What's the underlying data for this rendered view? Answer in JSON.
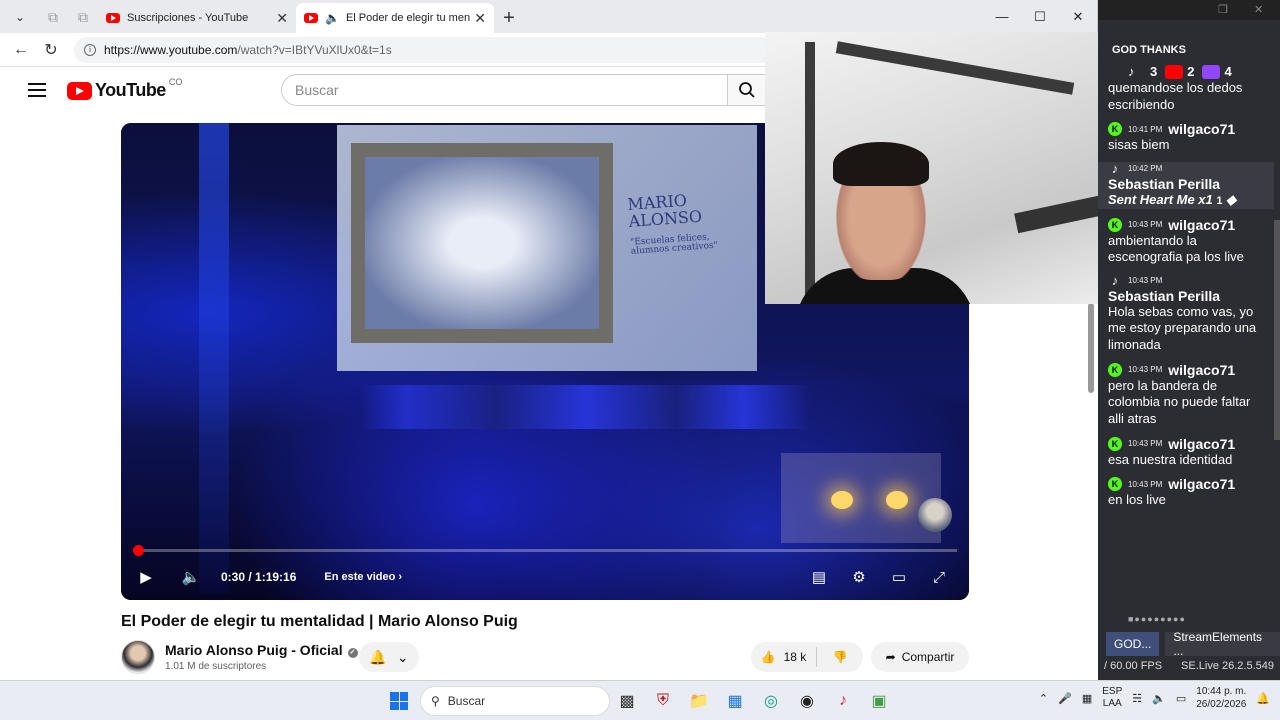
{
  "browser": {
    "tabs": [
      {
        "label": "Suscripciones - YouTube"
      },
      {
        "label": "El Poder de elegir tu mentalida"
      }
    ],
    "url_domain": "https://www.youtube.com",
    "url_path": "/watch?v=IBtYVuXlUx0&t=1s"
  },
  "youtube": {
    "logo": "YouTube",
    "country": "CO",
    "search_placeholder": "Buscar",
    "player": {
      "board_line1": "MARIO",
      "board_line2": "ALONSO",
      "board_tagline": "\"Escuelas felices, alumnos creativos\"",
      "time": "0:30 / 1:19:16",
      "chapter": "En este video",
      "progress_fraction": 0.0063
    },
    "video_title": "El Poder de elegir tu mentalidad | Mario Alonso Puig",
    "channel": "Mario Alonso Puig - Oficial",
    "subscribers": "1.01 M de suscriptores",
    "likes": "18 k",
    "share": "Compartir"
  },
  "panel": {
    "label": "GOD THANKS",
    "counts": {
      "tiktok": "3",
      "youtube": "2",
      "twitch": "4"
    },
    "chat": [
      {
        "platform": "kick",
        "time": "",
        "user": "",
        "text": "quemandose los dedos escribiendo",
        "partial": true
      },
      {
        "platform": "kick",
        "time": "10:41 PM",
        "user": "wilgaco71",
        "text": "sisas biem"
      },
      {
        "platform": "tiktok",
        "time": "10:42 PM",
        "user": "Sebastian Perilla",
        "text": "Sent Heart Me x1",
        "gift": "1",
        "highlight": true
      },
      {
        "platform": "kick",
        "time": "10:43 PM",
        "user": "wilgaco71",
        "text": "ambientando la escenografia pa los live"
      },
      {
        "platform": "tiktok",
        "time": "10:43 PM",
        "user": "Sebastian Perilla",
        "text": "Hola sebas como vas, yo me estoy preparando una limonada"
      },
      {
        "platform": "kick",
        "time": "10:43 PM",
        "user": "wilgaco71",
        "text": "pero la bandera de colombia no puede faltar alli atras"
      },
      {
        "platform": "kick",
        "time": "10:43 PM",
        "user": "wilgaco71",
        "text": "esa nuestra identidad"
      },
      {
        "platform": "kick",
        "time": "10:43 PM",
        "user": "wilgaco71",
        "text": "en los live"
      }
    ],
    "dock_tabs": [
      "GOD...",
      "StreamElements ..."
    ],
    "fps": "/ 60.00 FPS",
    "version": "SE.Live 26.2.5.549"
  },
  "taskbar": {
    "search": "Buscar",
    "lang1": "ESP",
    "lang2": "LAA",
    "time": "10:44 p. m.",
    "date": "26/02/2026"
  },
  "colors": {
    "yt_red": "#ff0000",
    "kick_green": "#53fc18",
    "twitch_purple": "#9146ff",
    "win_blue": "#1a74e8"
  }
}
